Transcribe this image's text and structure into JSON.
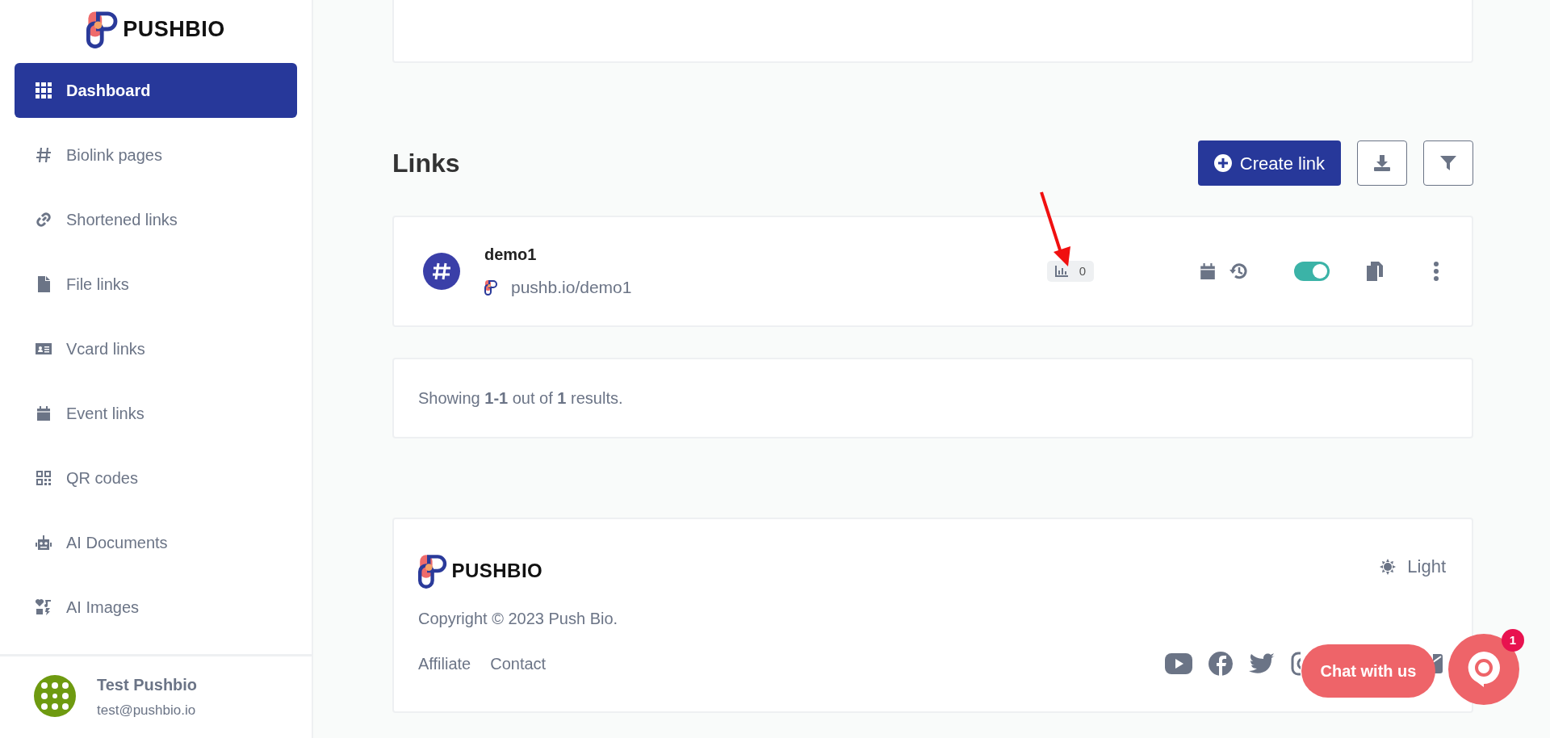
{
  "sidebar": {
    "logo": "PUSHBIO",
    "items": [
      {
        "label": "Dashboard",
        "selected": true
      },
      {
        "label": "Biolink pages",
        "selected": false
      },
      {
        "label": "Shortened links",
        "selected": false
      },
      {
        "label": "File links",
        "selected": false
      },
      {
        "label": "Vcard links",
        "selected": false
      },
      {
        "label": "Event links",
        "selected": false
      },
      {
        "label": "QR codes",
        "selected": false
      },
      {
        "label": "AI Documents",
        "selected": false
      },
      {
        "label": "AI Images",
        "selected": false
      }
    ],
    "user": {
      "name": "Test Pushbio",
      "email": "test@pushbio.io"
    }
  },
  "links_section": {
    "title": "Links",
    "create_button": "Create link",
    "links": [
      {
        "name": "demo1",
        "url": "pushb.io/demo1",
        "clicks": "0",
        "enabled": true
      }
    ]
  },
  "pagination": "Showing **1-1** out of **1** results.",
  "footer": {
    "logo": "PUSHBIO",
    "theme_label": "Light",
    "copyright": "Copyright © 2023 Push Bio.",
    "links": [
      "Affiliate",
      "Contact"
    ]
  },
  "chat": {
    "label": "Chat with us",
    "badge": "1"
  }
}
